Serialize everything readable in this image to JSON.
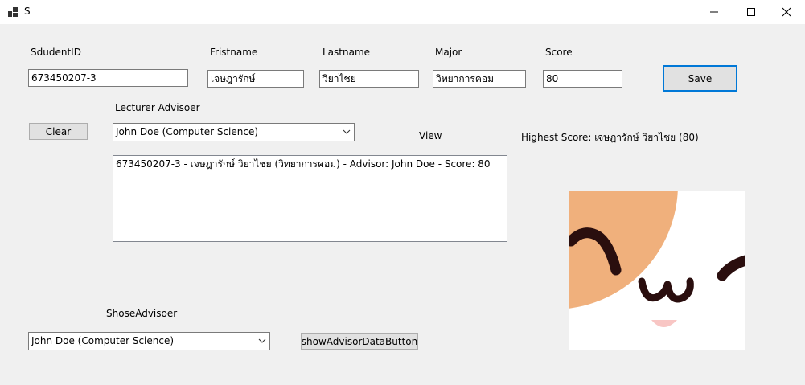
{
  "window": {
    "title": "S"
  },
  "labels": {
    "student_id": "SdudentID",
    "firstname": "Fristname",
    "lastname": "Lastname",
    "major": "Major",
    "score": "Score",
    "lecturer_advisor": "Lecturer Advisoer",
    "view": "View",
    "highest_score": "Highest Score: เจษฎารักษ์ วิยาไชย (80)",
    "choose_advisor": "ShoseAdvisoer"
  },
  "inputs": {
    "student_id": "673450207-3",
    "firstname": "เจษฎารักษ์",
    "lastname": "วิยาไชย",
    "major": "วิทยาการคอม",
    "score": "80"
  },
  "buttons": {
    "save": "Save",
    "clear": "Clear",
    "show_advisor": "showAdvisorDataButton"
  },
  "combos": {
    "lecturer_advisor": "John Doe (Computer Science)",
    "choose_advisor": "John Doe (Computer Science)"
  },
  "listbox": {
    "items": [
      "673450207-3 - เจษฎารักษ์ วิยาไชย (วิทยาการคอม) - Advisor: John Doe - Score: 80"
    ]
  },
  "colors": {
    "face": "#f0b07c",
    "eyes": "#2a0e0e",
    "blush": "#f8c6c4",
    "focus_border": "#0078d7"
  }
}
